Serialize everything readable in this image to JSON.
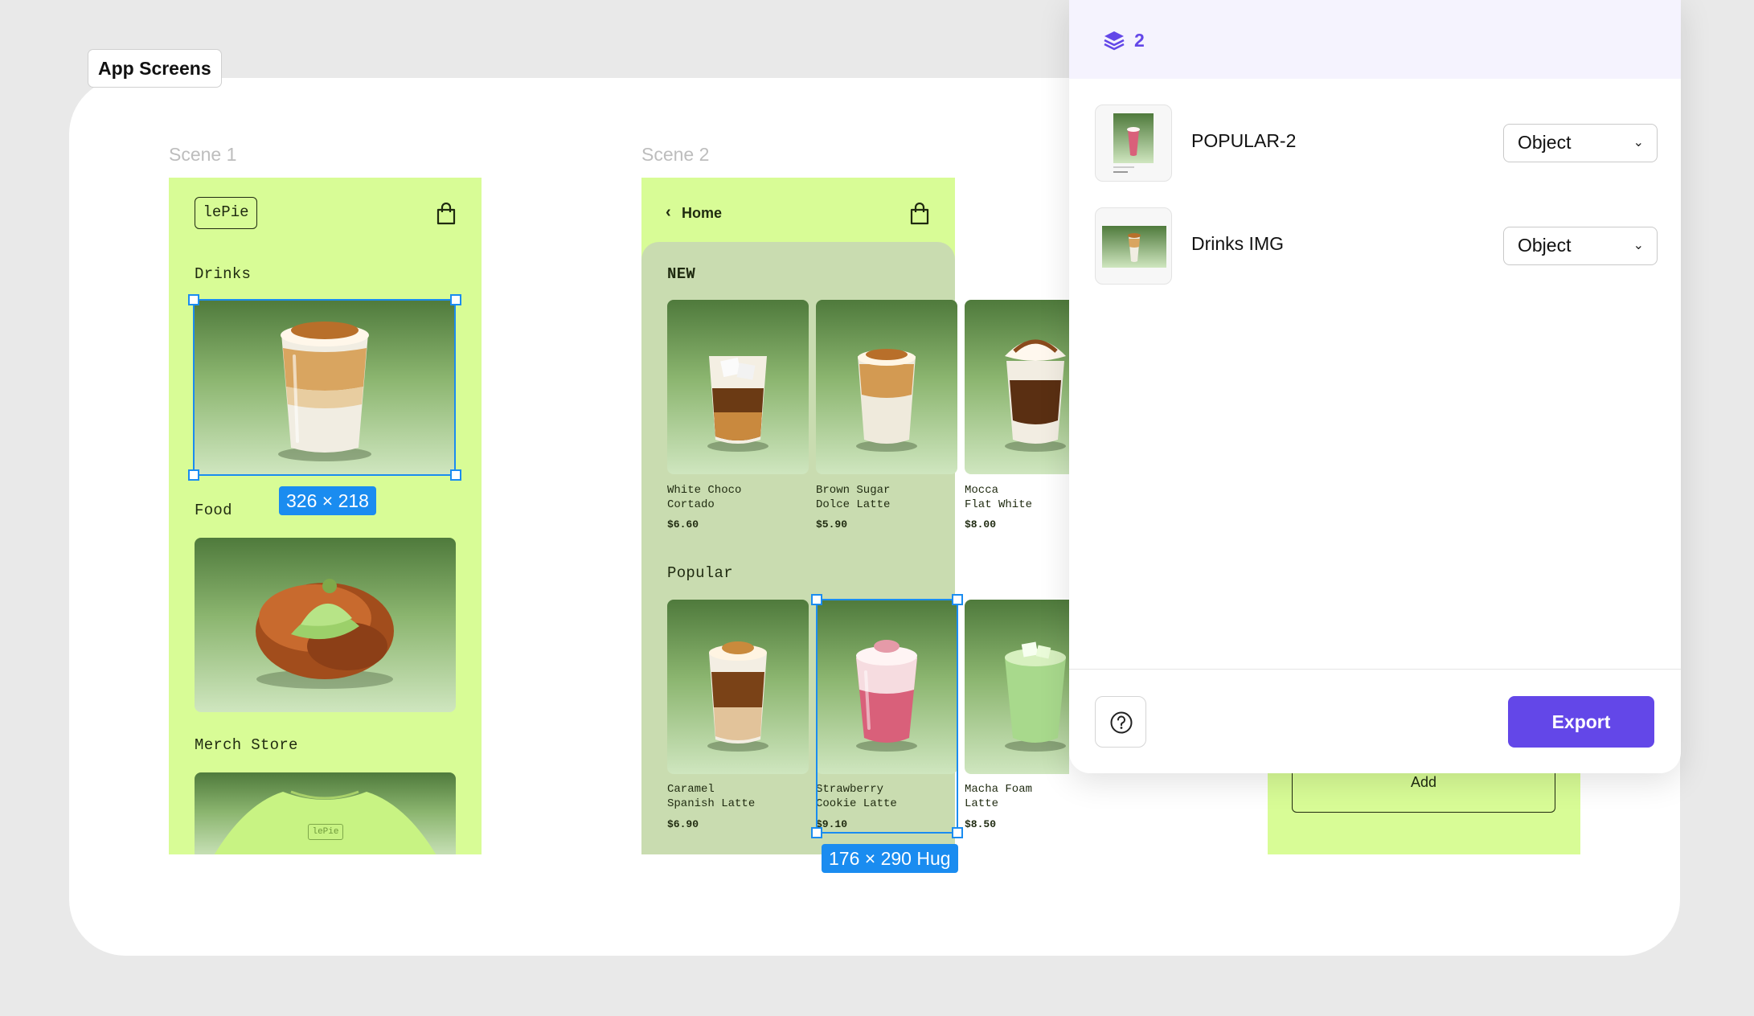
{
  "frame": {
    "title": "App Screens"
  },
  "scenes": [
    {
      "label": "Scene 1",
      "logo": "lePie",
      "sections": [
        "Drinks",
        "Food",
        "Merch Store"
      ],
      "merch_logo": "lePie",
      "selection_badge": "326 × 218"
    },
    {
      "label": "Scene 2",
      "back_label": "Home",
      "new_title": "NEW",
      "popular_title": "Popular",
      "new_items": [
        {
          "name": "White Choco\nCortado",
          "price": "$6.60"
        },
        {
          "name": "Brown Sugar\nDolce Latte",
          "price": "$5.90"
        },
        {
          "name": "Mocca\nFlat White",
          "price": "$8.00"
        }
      ],
      "popular_items": [
        {
          "name": "Caramel\nSpanish Latte",
          "price": "$6.90"
        },
        {
          "name": "Strawberry\nCookie Latte",
          "price": "$9.10"
        },
        {
          "name": "Macha Foam\nLatte",
          "price": "$8.50"
        }
      ],
      "selection_badge": "176 × 290 Hug"
    }
  ],
  "scene3": {
    "add_label": "Add"
  },
  "panel": {
    "layer_count": "2",
    "layers": [
      {
        "name": "POPULAR-2",
        "type": "Object"
      },
      {
        "name": "Drinks IMG",
        "type": "Object"
      }
    ],
    "export_label": "Export",
    "accent": "#6347e8"
  },
  "colors": {
    "phone_bg": "#d8fc96",
    "selection": "#1a8cf0"
  }
}
